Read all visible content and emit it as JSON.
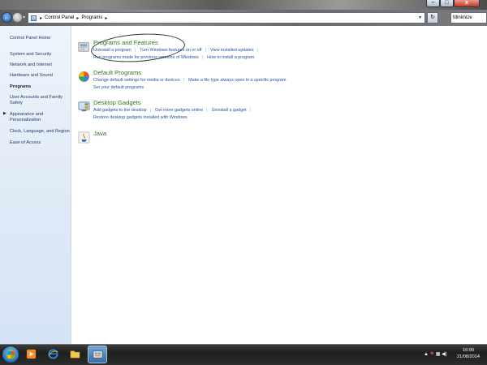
{
  "window": {
    "title_controls": {
      "minimize": "–",
      "maximize": "□",
      "close": "x"
    }
  },
  "address": {
    "back_icon": "back-arrow-icon",
    "forward_icon": "forward-arrow-icon",
    "breadcrumbs": [
      "Control Panel",
      "Programs"
    ],
    "separator": "▸",
    "search_value": "Minimize",
    "refresh_icon": "refresh-icon"
  },
  "sidebar": {
    "items": [
      {
        "label": "Control Panel Home"
      },
      {
        "label": "System and Security"
      },
      {
        "label": "Network and Internet"
      },
      {
        "label": "Hardware and Sound"
      },
      {
        "label": "Programs",
        "current": true
      },
      {
        "label": "User Accounts and Family Safety"
      },
      {
        "label": "Appearance and Personalization"
      },
      {
        "label": "Clock, Language, and Region"
      },
      {
        "label": "Ease of Access"
      }
    ],
    "current_marker": "▶"
  },
  "categories": [
    {
      "title": "Programs and Features",
      "icon": "programs-features-icon",
      "lines": [
        [
          "Uninstall a program",
          "Turn Windows features on or off",
          "View installed updates"
        ],
        [
          "Run programs made for previous versions of Windows",
          "How to install a program"
        ]
      ]
    },
    {
      "title": "Default Programs",
      "icon": "default-programs-icon",
      "lines": [
        [
          "Change default settings for media or devices",
          "Make a file type always open in a specific program"
        ],
        [
          "Set your default programs"
        ]
      ]
    },
    {
      "title": "Desktop Gadgets",
      "icon": "desktop-gadgets-icon",
      "lines": [
        [
          "Add gadgets to the desktop",
          "Get more gadgets online",
          "Uninstall a gadget"
        ],
        [
          "Restore desktop gadgets installed with Windows"
        ]
      ]
    },
    {
      "title": "Java",
      "icon": "java-icon",
      "lines": []
    }
  ],
  "taskbar": {
    "clock_time": "16:00",
    "clock_date": "21/08/2014",
    "colors": {
      "start_orb": "#3a83c9",
      "taskbar": "#1f1f1f"
    }
  }
}
